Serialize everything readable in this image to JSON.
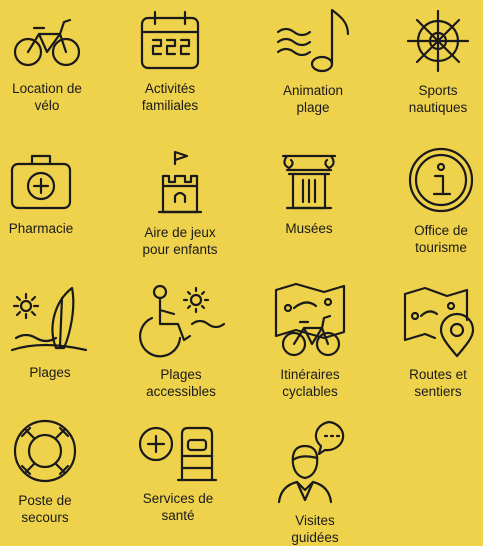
{
  "background_color": "#EFD24B",
  "ink_color": "#1a1a1a",
  "items": [
    {
      "icon": "bicycle-icon",
      "label": "Location de\nvélo"
    },
    {
      "icon": "calendar-icon",
      "label": "Activités\nfamiliales"
    },
    {
      "icon": "music-note-waves-icon",
      "label": "Animation\nplage"
    },
    {
      "icon": "ship-wheel-icon",
      "label": "Sports\nnautiques"
    },
    {
      "icon": "first-aid-kit-icon",
      "label": "Pharmacie"
    },
    {
      "icon": "castle-icon",
      "label": "Aire de jeux\npour enfants"
    },
    {
      "icon": "museum-icon",
      "label": "Musées"
    },
    {
      "icon": "info-icon",
      "label": "Office de\ntourisme"
    },
    {
      "icon": "beach-surfboard-icon",
      "label": "Plages"
    },
    {
      "icon": "wheelchair-beach-icon",
      "label": "Plages\naccessibles"
    },
    {
      "icon": "bike-map-icon",
      "label": "Itinéraires\ncyclables"
    },
    {
      "icon": "map-pin-icon",
      "label": "Routes et\nsentiers"
    },
    {
      "icon": "lifebuoy-icon",
      "label": "Poste de\nsecours"
    },
    {
      "icon": "health-services-icon",
      "label": "Services de\nsanté"
    },
    {
      "icon": "guide-speech-icon",
      "label": "Visites\nguidées"
    }
  ]
}
